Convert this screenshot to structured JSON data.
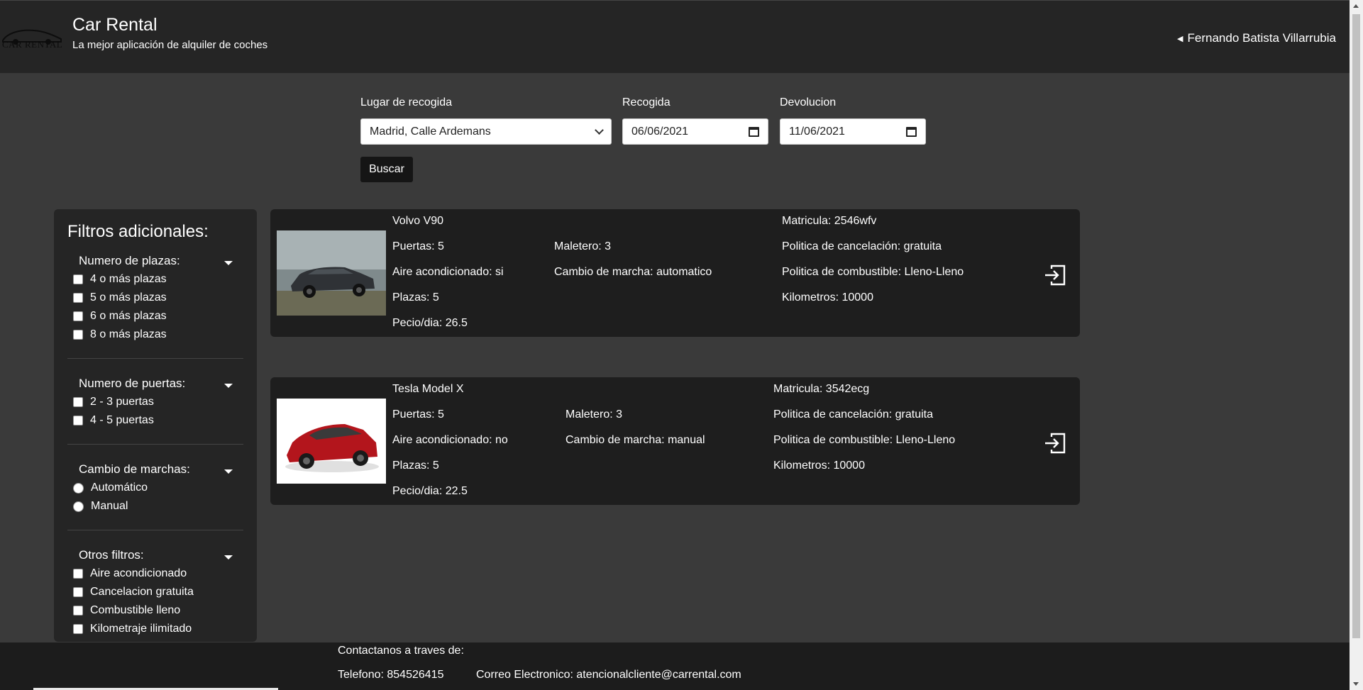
{
  "header": {
    "logo_text": "CAR RENTAL",
    "title": "Car Rental",
    "subtitle": "La mejor aplicación de alquiler de coches",
    "user_name": "Fernando Batista Villarrubia"
  },
  "search": {
    "location_label": "Lugar de recogida",
    "location_value": "Madrid, Calle Ardemans",
    "pickup_label": "Recogida",
    "pickup_value": "06/06/2021",
    "return_label": "Devolucion",
    "return_value": "11/06/2021",
    "search_button": "Buscar"
  },
  "filters": {
    "title": "Filtros adicionales:",
    "seats": {
      "label": "Numero de plazas:",
      "options": [
        "4 o más plazas",
        "5 o más plazas",
        "6 o más plazas",
        "8 o más plazas"
      ]
    },
    "doors": {
      "label": "Numero de puertas:",
      "options": [
        "2 - 3 puertas",
        "4 - 5 puertas"
      ]
    },
    "gearbox": {
      "label": "Cambio de marchas:",
      "options": [
        "Automático",
        "Manual"
      ]
    },
    "others": {
      "label": "Otros filtros:",
      "options": [
        "Aire acondicionado",
        "Cancelacion gratuita",
        "Combustible lleno",
        "Kilometraje ilimitado"
      ]
    }
  },
  "cars": [
    {
      "name": "Volvo V90",
      "doors": "Puertas: 5",
      "trunk": "Maletero: 3",
      "ac": "Aire acondicionado: si",
      "gearbox": "Cambio de marcha: automatico",
      "seats": "Plazas: 5",
      "price": "Pecio/dia: 26.5",
      "plate": "Matricula: 2546wfv",
      "cancellation": "Politica de cancelación: gratuita",
      "fuel": "Politica de combustible: Lleno-Lleno",
      "km": "Kilometros: 10000",
      "color": "#2f3236"
    },
    {
      "name": "Tesla Model X",
      "doors": "Puertas: 5",
      "trunk": "Maletero: 3",
      "ac": "Aire acondicionado: no",
      "gearbox": "Cambio de marcha: manual",
      "seats": "Plazas: 5",
      "price": "Pecio/dia: 22.5",
      "plate": "Matricula: 3542ecg",
      "cancellation": "Politica de cancelación: gratuita",
      "fuel": "Politica de combustible: Lleno-Lleno",
      "km": "Kilometros: 10000",
      "color": "#b3151c"
    }
  ],
  "footer": {
    "contact_title": "Contactanos a traves de:",
    "phone": "Telefono: 854526415",
    "email": "Correo Electronico: atencionalcliente@carrental.com"
  },
  "icons": {
    "book": "enter-icon",
    "dropdown": "chevron-down-icon",
    "calendar": "calendar-icon",
    "user_caret": "caret-left-icon"
  }
}
